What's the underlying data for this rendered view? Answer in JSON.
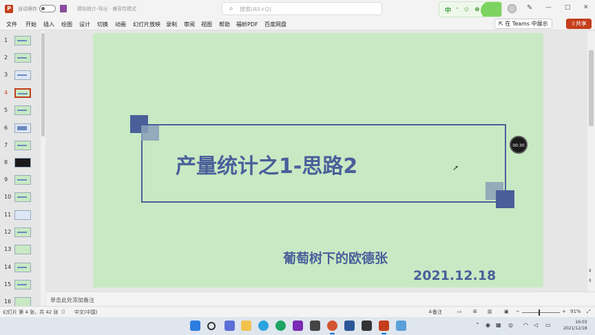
{
  "titlebar": {
    "autosave_label": "自动保存",
    "doc_title": "模拟统计-导出 · 兼容性模式",
    "search_placeholder": "搜索(Alt+Q)",
    "ime_char": "中",
    "ime_dots": "° ☺ ☻",
    "window_buttons": [
      "—",
      "□",
      "✕"
    ]
  },
  "menu": {
    "items": [
      "文件",
      "开始",
      "插入",
      "绘图",
      "设计",
      "切换",
      "动画",
      "幻灯片放映",
      "录制",
      "审阅",
      "视图",
      "帮助",
      "福昕PDF",
      "百度网盘"
    ],
    "teams_label": "在 Teams 中展示",
    "share_label": "共享"
  },
  "thumbnails": {
    "numbers": [
      "1",
      "2",
      "3",
      "4",
      "5",
      "6",
      "7",
      "8",
      "9",
      "10",
      "11",
      "12",
      "13",
      "14",
      "15",
      "16"
    ],
    "active_index": 4
  },
  "slide": {
    "title": "产量统计之1-思路2",
    "author": "葡萄树下的欧德张",
    "date": "2021.12.18",
    "timer": "00:30"
  },
  "notes": {
    "placeholder": "单击此处添加备注"
  },
  "status": {
    "slide_info": "幻灯片 第 4 张，共 42 张",
    "language": "中文(中国)",
    "notes_label": "备注",
    "zoom": "91%"
  },
  "taskbar": {
    "time": "16:03",
    "date": "2021/12/18"
  },
  "colors": {
    "accent": "#c43e1c",
    "slide_bg": "#c9e9c4",
    "slide_blue": "#4a5f9a"
  }
}
